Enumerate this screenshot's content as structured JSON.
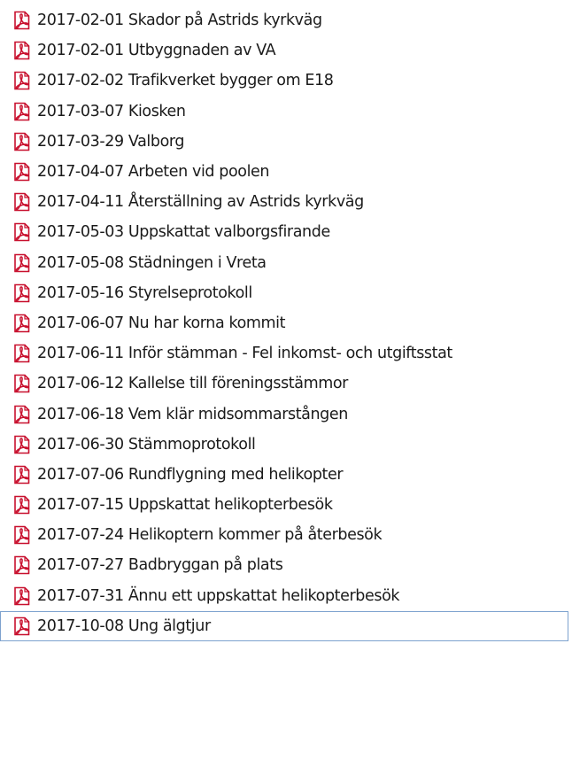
{
  "file_list": {
    "items": [
      {
        "name": "2017-02-01 Skador på Astrids kyrkväg",
        "icon": "pdf-file-icon"
      },
      {
        "name": "2017-02-01 Utbyggnaden av VA",
        "icon": "pdf-file-icon"
      },
      {
        "name": "2017-02-02 Trafikverket bygger om E18",
        "icon": "pdf-file-icon"
      },
      {
        "name": "2017-03-07 Kiosken",
        "icon": "pdf-file-icon"
      },
      {
        "name": "2017-03-29 Valborg",
        "icon": "pdf-file-icon"
      },
      {
        "name": "2017-04-07 Arbeten vid poolen",
        "icon": "pdf-file-icon"
      },
      {
        "name": "2017-04-11 Återställning av Astrids kyrkväg",
        "icon": "pdf-file-icon"
      },
      {
        "name": "2017-05-03 Uppskattat valborgsfirande",
        "icon": "pdf-file-icon"
      },
      {
        "name": "2017-05-08 Städningen i Vreta",
        "icon": "pdf-file-icon"
      },
      {
        "name": "2017-05-16 Styrelseprotokoll",
        "icon": "pdf-file-icon"
      },
      {
        "name": "2017-06-07 Nu har korna kommit",
        "icon": "pdf-file-icon"
      },
      {
        "name": "2017-06-11 Inför stämman - Fel inkomst- och utgiftsstat",
        "icon": "pdf-file-icon"
      },
      {
        "name": "2017-06-12 Kallelse till föreningsstämmor",
        "icon": "pdf-file-icon"
      },
      {
        "name": "2017-06-18 Vem klär midsommarstången",
        "icon": "pdf-file-icon"
      },
      {
        "name": "2017-06-30 Stämmoprotokoll",
        "icon": "pdf-file-icon"
      },
      {
        "name": "2017-07-06 Rundflygning med helikopter",
        "icon": "pdf-file-icon"
      },
      {
        "name": "2017-07-15 Uppskattat helikopterbesök",
        "icon": "pdf-file-icon"
      },
      {
        "name": "2017-07-24 Helikoptern kommer på återbesök",
        "icon": "pdf-file-icon"
      },
      {
        "name": "2017-07-27 Badbryggan på plats",
        "icon": "pdf-file-icon"
      },
      {
        "name": "2017-07-31 Ännu ett uppskattat helikopterbesök",
        "icon": "pdf-file-icon"
      },
      {
        "name": "2017-10-08 Ung älgtjur",
        "icon": "pdf-file-icon",
        "focused": true
      }
    ]
  },
  "colors": {
    "icon_red": "#c8102e",
    "focus_border": "#7da2ce",
    "text": "#1a1a1a"
  }
}
